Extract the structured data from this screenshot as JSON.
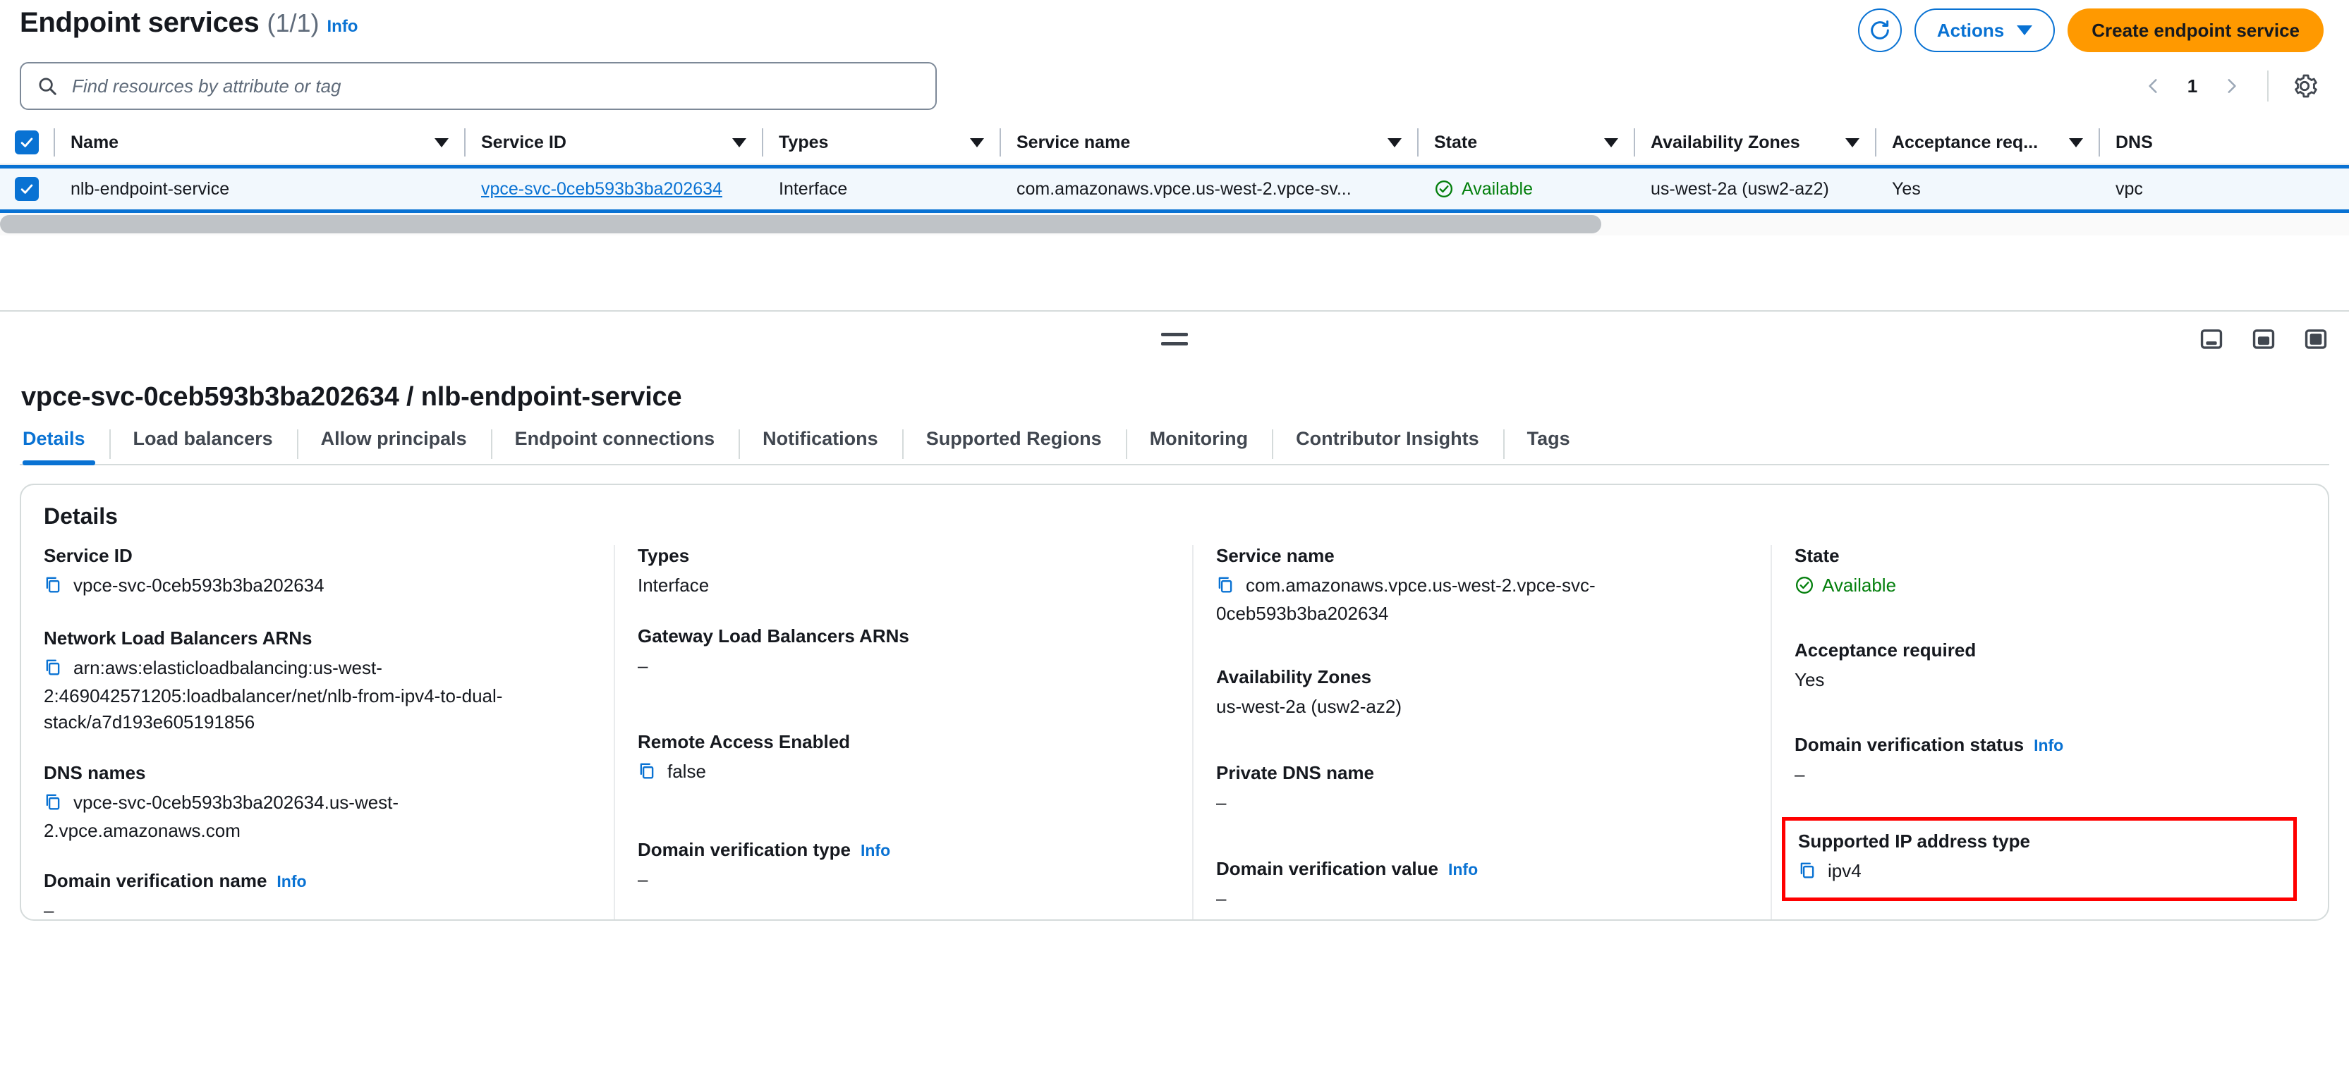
{
  "header": {
    "title": "Endpoint services",
    "count": "(1/1)",
    "info": "Info",
    "refresh_icon": "refresh-icon",
    "actions_label": "Actions",
    "create_label": "Create endpoint service"
  },
  "search": {
    "placeholder": "Find resources by attribute or tag",
    "icon": "search-icon"
  },
  "pagination": {
    "prev": "‹",
    "page": "1",
    "next": "›",
    "settings_icon": "gear-icon"
  },
  "table": {
    "columns": [
      {
        "label": "Name"
      },
      {
        "label": "Service ID"
      },
      {
        "label": "Types"
      },
      {
        "label": "Service name"
      },
      {
        "label": "State"
      },
      {
        "label": "Availability Zones"
      },
      {
        "label": "Acceptance req..."
      },
      {
        "label": "DNS"
      }
    ],
    "rows": [
      {
        "selected": true,
        "name": "nlb-endpoint-service",
        "service_id": "vpce-svc-0ceb593b3ba202634",
        "types": "Interface",
        "service_name": "com.amazonaws.vpce.us-west-2.vpce-sv...",
        "state": "Available",
        "availability_zones": "us-west-2a (usw2-az2)",
        "acceptance_required": "Yes",
        "dns": "vpc"
      }
    ]
  },
  "detail": {
    "title": "vpce-svc-0ceb593b3ba202634 / nlb-endpoint-service",
    "tabs": [
      {
        "label": "Details",
        "active": true
      },
      {
        "label": "Load balancers",
        "active": false
      },
      {
        "label": "Allow principals",
        "active": false
      },
      {
        "label": "Endpoint connections",
        "active": false
      },
      {
        "label": "Notifications",
        "active": false
      },
      {
        "label": "Supported Regions",
        "active": false
      },
      {
        "label": "Monitoring",
        "active": false
      },
      {
        "label": "Contributor Insights",
        "active": false
      },
      {
        "label": "Tags",
        "active": false
      }
    ],
    "card_title": "Details",
    "col1": {
      "f1_label": "Service ID",
      "f1_value": "vpce-svc-0ceb593b3ba202634",
      "f2_label": "Network Load Balancers ARNs",
      "f2_value": "arn:aws:elasticloadbalancing:us-west-2:469042571205:loadbalancer/net/nlb-from-ipv4-to-dual-stack/a7d193e605191856",
      "f3_label": "DNS names",
      "f3_value": "vpce-svc-0ceb593b3ba202634.us-west-2.vpce.amazonaws.com",
      "f4_label": "Domain verification name",
      "f4_info": "Info",
      "f4_value": "–"
    },
    "col2": {
      "f1_label": "Types",
      "f1_value": "Interface",
      "f2_label": "Gateway Load Balancers ARNs",
      "f2_value": "–",
      "f3_label": "Remote Access Enabled",
      "f3_value": "false",
      "f4_label": "Domain verification type",
      "f4_info": "Info",
      "f4_value": "–"
    },
    "col3": {
      "f1_label": "Service name",
      "f1_value": "com.amazonaws.vpce.us-west-2.vpce-svc-0ceb593b3ba202634",
      "f2_label": "Availability Zones",
      "f2_value": "us-west-2a (usw2-az2)",
      "f3_label": "Private DNS name",
      "f3_value": "–",
      "f4_label": "Domain verification value",
      "f4_info": "Info",
      "f4_value": "–"
    },
    "col4": {
      "f1_label": "State",
      "f1_value": "Available",
      "f2_label": "Acceptance required",
      "f2_value": "Yes",
      "f3_label": "Domain verification status",
      "f3_info": "Info",
      "f3_value": "–",
      "f4_label": "Supported IP address type",
      "f4_value": "ipv4"
    }
  },
  "splitter": {
    "drag_handle": "drag-handle",
    "panel_icons": [
      "panel-small-icon",
      "panel-medium-icon",
      "panel-large-icon"
    ]
  },
  "colors": {
    "accent": "#0972d3",
    "primary_button": "#ff9900",
    "success": "#037f0c",
    "highlight": "#ff0000"
  }
}
